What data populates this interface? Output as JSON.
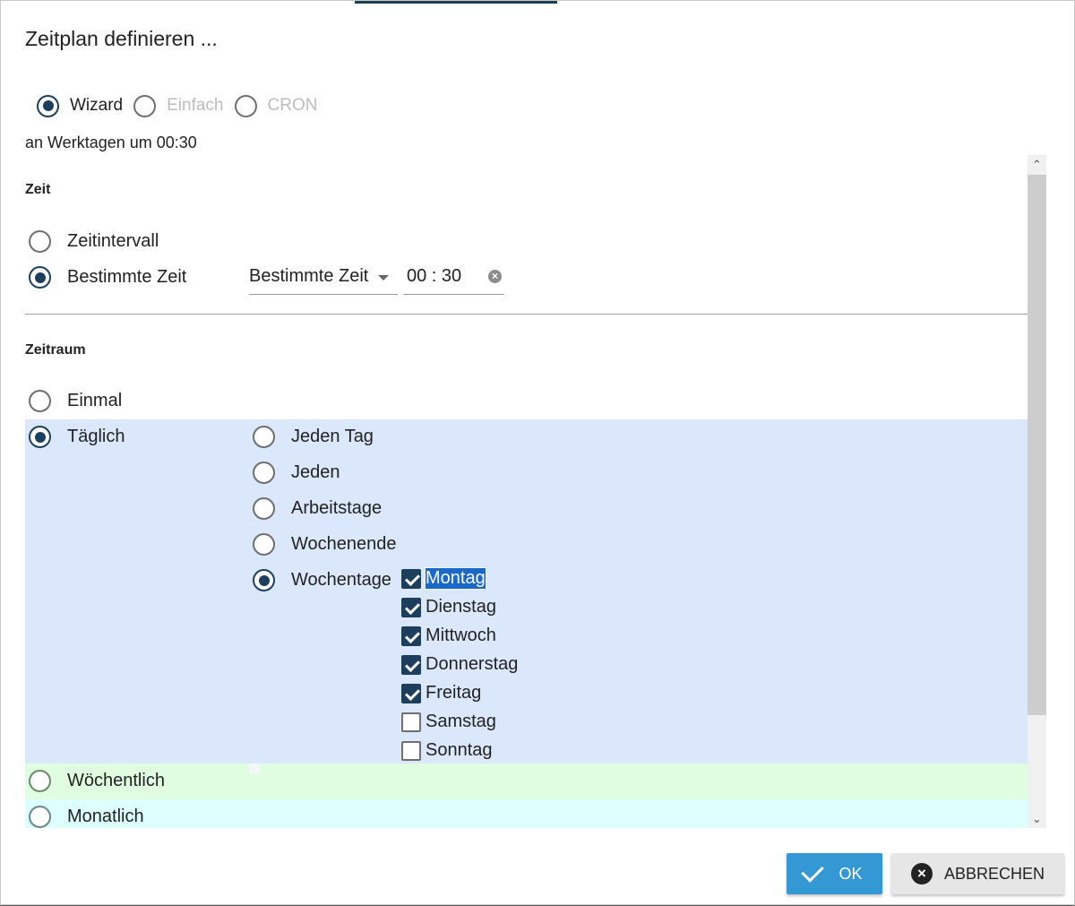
{
  "dialog": {
    "title": "Zeitplan definieren ..."
  },
  "mode": {
    "options": [
      {
        "label": "Wizard",
        "checked": true,
        "disabled": false
      },
      {
        "label": "Einfach",
        "checked": false,
        "disabled": true
      },
      {
        "label": "CRON",
        "checked": false,
        "disabled": true
      }
    ]
  },
  "summary": "an Werktagen um 00:30",
  "zeit": {
    "title": "Zeit",
    "options": [
      "Zeitintervall",
      "Bestimmte Zeit"
    ],
    "selected": "Bestimmte Zeit",
    "type_select": "Bestimmte Zeit",
    "time_value": "00 : 30"
  },
  "zeitraum": {
    "title": "Zeitraum",
    "options": [
      "Einmal",
      "Täglich",
      "Wöchentlich",
      "Monatlich"
    ],
    "selected": "Täglich",
    "daily": {
      "options": [
        "Jeden Tag",
        "Jeden",
        "Arbeitstage",
        "Wochenende",
        "Wochentage"
      ],
      "selected": "Wochentage",
      "weekdays": [
        {
          "label": "Montag",
          "checked": true,
          "focused": true
        },
        {
          "label": "Dienstag",
          "checked": true
        },
        {
          "label": "Mittwoch",
          "checked": true
        },
        {
          "label": "Donnerstag",
          "checked": true
        },
        {
          "label": "Freitag",
          "checked": true
        },
        {
          "label": "Samstag",
          "checked": false
        },
        {
          "label": "Sonntag",
          "checked": false
        }
      ]
    }
  },
  "buttons": {
    "ok": "OK",
    "cancel": "ABBRECHEN"
  },
  "icons": {
    "ok": "check-icon",
    "cancel": "close-circle-icon",
    "clear": "clear-icon",
    "dropdown": "chevron-down-icon"
  },
  "colors": {
    "accent": "#1c3f5e",
    "ok_button": "#3398d4",
    "band_daily": "#dbe8fb",
    "band_weekly": "#e1fde1",
    "band_monthly": "#ddfffe"
  }
}
